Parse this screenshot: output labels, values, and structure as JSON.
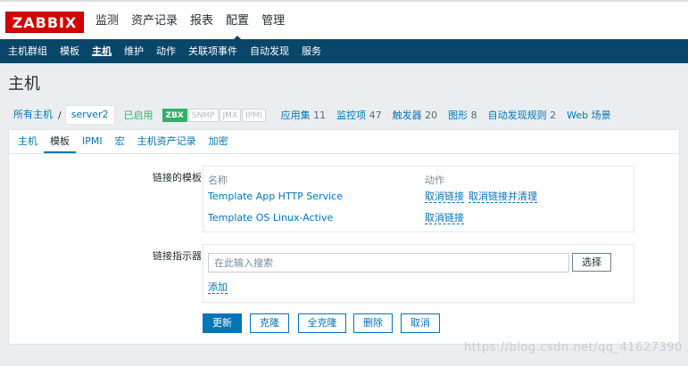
{
  "logo": {
    "text": "ZABBIX"
  },
  "top_menu": [
    "监测",
    "资产记录",
    "报表",
    "配置",
    "管理"
  ],
  "top_menu_active": "配置",
  "sub_menu": [
    "主机群组",
    "模板",
    "主机",
    "维护",
    "动作",
    "关联项事件",
    "自动发现",
    "服务"
  ],
  "sub_menu_active": "主机",
  "page_title": "主机",
  "breadcrumb": {
    "all_hosts": "所有主机",
    "separator": "/",
    "current": "server2",
    "status": "已启用",
    "availability": [
      "ZBX",
      "SNMP",
      "JMX",
      "IPMI"
    ],
    "links": [
      {
        "label": "应用集",
        "count": "11"
      },
      {
        "label": "监控项",
        "count": "47"
      },
      {
        "label": "触发器",
        "count": "20"
      },
      {
        "label": "图形",
        "count": "8"
      },
      {
        "label": "自动发现规则",
        "count": "2"
      },
      {
        "label": "Web 场景",
        "count": ""
      }
    ]
  },
  "tabs": [
    "主机",
    "模板",
    "IPMI",
    "宏",
    "主机资产记录",
    "加密"
  ],
  "tab_active": "模板",
  "linked_templates": {
    "label": "链接的模板",
    "col_name": "名称",
    "col_action": "动作",
    "rows": [
      {
        "name": "Template App HTTP Service",
        "unlink": "取消链接",
        "unlink_clear": "取消链接并清理"
      },
      {
        "name": "Template OS Linux-Active",
        "unlink": "取消链接",
        "unlink_clear": ""
      }
    ]
  },
  "link_indicator": {
    "label": "链接指示器",
    "placeholder": "在此输入搜索",
    "select_label": "选择",
    "add_label": "添加"
  },
  "buttons": {
    "update": "更新",
    "clone": "克隆",
    "full_clone": "全克隆",
    "delete": "删除",
    "cancel": "取消"
  },
  "watermark": "https://blog.csdn.net/qq_41627390",
  "colors": {
    "brand_red": "#d40000",
    "nav_blue": "#0a466a",
    "link_blue": "#0275b8",
    "enabled_green": "#34af67"
  }
}
